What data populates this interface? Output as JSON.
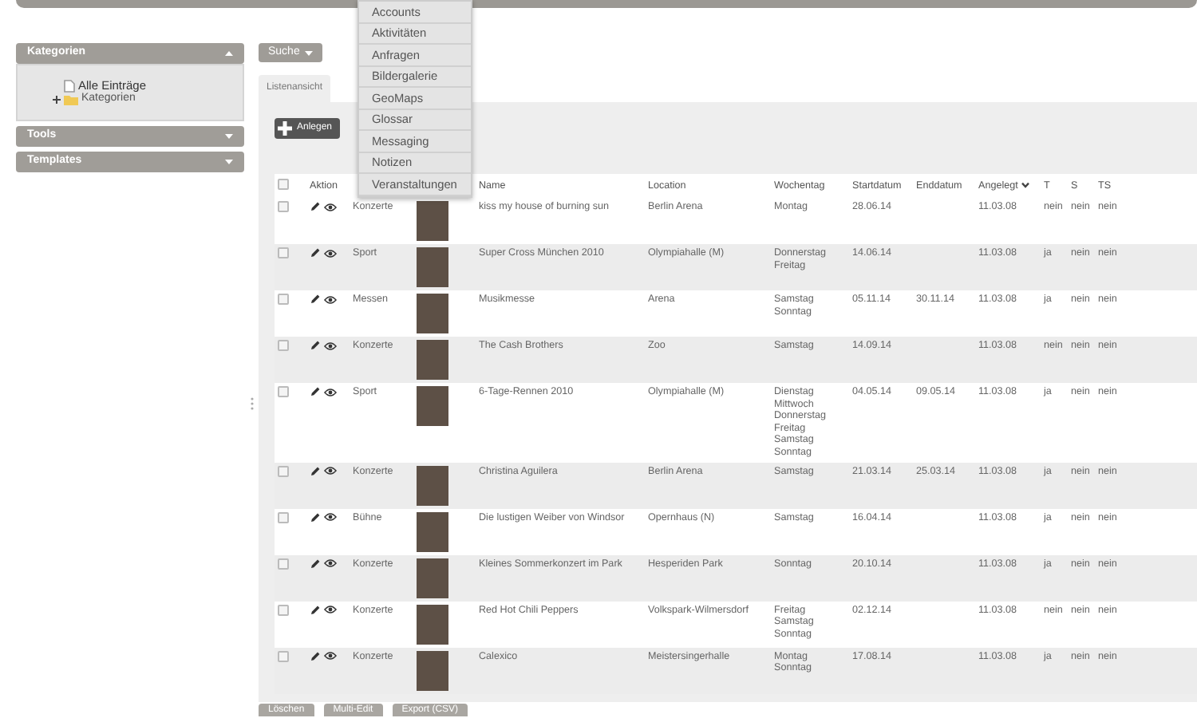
{
  "sidebar": {
    "panels": [
      {
        "title": "Kategorien",
        "expanded": true,
        "tree": [
          {
            "label": "Alle Einträge",
            "kind": "page"
          },
          {
            "label": "Kategorien",
            "kind": "folder",
            "expanded": false
          }
        ]
      },
      {
        "title": "Tools",
        "expanded": false
      },
      {
        "title": "Templates",
        "expanded": false
      }
    ]
  },
  "search_button": {
    "label": "Suche"
  },
  "dropdown_menu": [
    "Accounts",
    "Aktivitäten",
    "Anfragen",
    "Bildergalerie",
    "GeoMaps",
    "Glossar",
    "Messaging",
    "Notizen",
    "Veranstaltungen"
  ],
  "tabs": [
    {
      "label": "Listenansicht",
      "selected": true
    }
  ],
  "create_button": {
    "label": "Anlegen"
  },
  "table": {
    "select_all_checked": false,
    "columns": [
      {
        "label": "Aktion"
      },
      {
        "label": "Name"
      },
      {
        "label": "Location"
      },
      {
        "label": "Wochentag"
      },
      {
        "label": "Startdatum"
      },
      {
        "label": "Enddatum"
      },
      {
        "label": "Angelegt",
        "sorted_descending": true
      },
      {
        "label": "T"
      },
      {
        "label": "S"
      },
      {
        "label": "TS"
      }
    ],
    "rows": [
      {
        "checked": false,
        "category": "Konzerte",
        "name": "kiss my house of burning sun",
        "location": "Berlin Arena",
        "weekdays": [
          "Montag"
        ],
        "start": "28.06.14",
        "end": "",
        "created": "11.03.08",
        "t": "nein",
        "s": "nein",
        "ts": "nein"
      },
      {
        "checked": false,
        "category": "Sport",
        "name": "Super Cross München 2010",
        "location": "Olympiahalle (M)",
        "weekdays": [
          "Donnerstag",
          "Freitag"
        ],
        "start": "14.06.14",
        "end": "",
        "created": "11.03.08",
        "t": "ja",
        "s": "nein",
        "ts": "nein"
      },
      {
        "checked": false,
        "category": "Messen",
        "name": "Musikmesse",
        "location": "Arena",
        "weekdays": [
          "Samstag",
          "Sonntag"
        ],
        "start": "05.11.14",
        "end": "30.11.14",
        "created": "11.03.08",
        "t": "ja",
        "s": "nein",
        "ts": "nein"
      },
      {
        "checked": false,
        "category": "Konzerte",
        "name": "The Cash Brothers",
        "location": "Zoo",
        "weekdays": [
          "Samstag"
        ],
        "start": "14.09.14",
        "end": "",
        "created": "11.03.08",
        "t": "nein",
        "s": "nein",
        "ts": "nein"
      },
      {
        "checked": false,
        "category": "Sport",
        "name": "6-Tage-Rennen 2010",
        "location": "Olympiahalle (M)",
        "weekdays": [
          "Dienstag",
          "Mittwoch",
          "Donnerstag",
          "Freitag",
          "Samstag",
          "Sonntag"
        ],
        "start": "04.05.14",
        "end": "09.05.14",
        "created": "11.03.08",
        "t": "ja",
        "s": "nein",
        "ts": "nein"
      },
      {
        "checked": false,
        "category": "Konzerte",
        "name": "Christina Aguilera",
        "location": "Berlin Arena",
        "weekdays": [
          "Samstag"
        ],
        "start": "21.03.14",
        "end": "25.03.14",
        "created": "11.03.08",
        "t": "ja",
        "s": "nein",
        "ts": "nein"
      },
      {
        "checked": false,
        "category": "Bühne",
        "name": "Die lustigen Weiber von Windsor",
        "location": "Opernhaus (N)",
        "weekdays": [
          "Samstag"
        ],
        "start": "16.04.14",
        "end": "",
        "created": "11.03.08",
        "t": "ja",
        "s": "nein",
        "ts": "nein"
      },
      {
        "checked": false,
        "category": "Konzerte",
        "name": "Kleines Sommerkonzert im Park",
        "location": "Hesperiden Park",
        "weekdays": [
          "Sonntag"
        ],
        "start": "20.10.14",
        "end": "",
        "created": "11.03.08",
        "t": "ja",
        "s": "nein",
        "ts": "nein"
      },
      {
        "checked": false,
        "category": "Konzerte",
        "name": "Red Hot Chili Peppers",
        "location": "Volkspark-Wilmersdorf",
        "weekdays": [
          "Freitag",
          "Samstag",
          "Sonntag"
        ],
        "start": "02.12.14",
        "end": "",
        "created": "11.03.08",
        "t": "nein",
        "s": "nein",
        "ts": "nein"
      },
      {
        "checked": false,
        "category": "Konzerte",
        "name": "Calexico",
        "location": "Meistersingerhalle",
        "weekdays": [
          "Montag",
          "Sonntag"
        ],
        "start": "17.08.14",
        "end": "",
        "created": "11.03.08",
        "t": "ja",
        "s": "nein",
        "ts": "nein"
      }
    ]
  },
  "footer_buttons": [
    "Löschen",
    "Multi-Edit",
    "Export (CSV)"
  ]
}
